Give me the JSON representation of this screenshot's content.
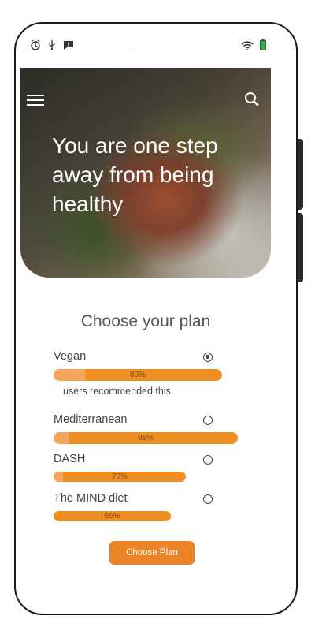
{
  "hero": {
    "title": "You are one step away from being healthy"
  },
  "section": {
    "heading": "Choose your plan"
  },
  "plans": [
    {
      "name": "Vegan",
      "percent_label": "80%",
      "percent": 80,
      "selected": true,
      "note": "users recommended this"
    },
    {
      "name": "Mediterranean",
      "percent_label": "95%",
      "percent": 95,
      "selected": false
    },
    {
      "name": "DASH",
      "percent_label": "70%",
      "percent": 70,
      "selected": false
    },
    {
      "name": "The MIND diet",
      "percent_label": "65%",
      "percent": 65,
      "selected": false
    }
  ],
  "action": {
    "choose_label": "Choose Plan"
  },
  "colors": {
    "accent": "#ec8326",
    "bar": "#ef8f22",
    "bar_highlight": "#f4a75a"
  }
}
